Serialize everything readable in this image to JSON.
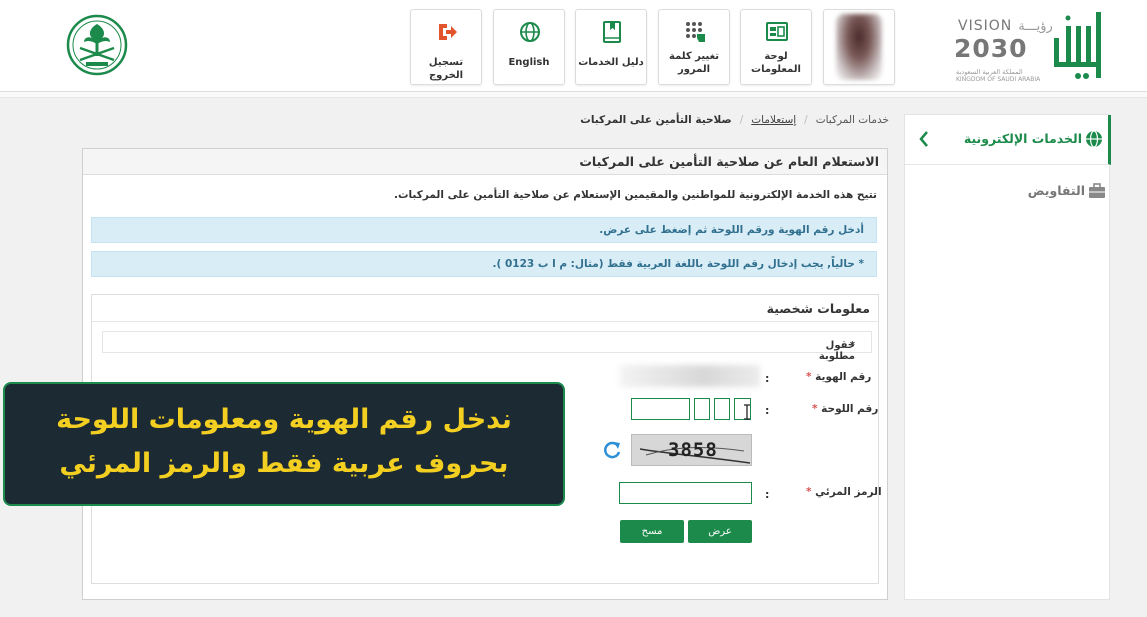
{
  "header": {
    "logo": {
      "vision_word": "VISION",
      "vision_arabic": "رؤيـــة",
      "year": "2030",
      "kingdom_ar": "المملكة العربية السعودية",
      "kingdom_en": "KINGDOM OF SAUDI ARABIA",
      "icon": "absher-logo"
    },
    "tiles": [
      {
        "label": "",
        "icon": "user-avatar"
      },
      {
        "label": "لوحة المعلومات",
        "icon": "dashboard-icon"
      },
      {
        "label": "تغيير كلمة المرور",
        "icon": "keypad-icon"
      },
      {
        "label": "دليل الخدمات",
        "icon": "book-icon"
      },
      {
        "label": "English",
        "icon": "globe-icon"
      },
      {
        "label": "تسجيل الخروج",
        "icon": "logout-icon"
      }
    ],
    "emblem": "saudi-emblem"
  },
  "sidebar": {
    "items": [
      {
        "label": "الخدمات الإلكترونية",
        "icon": "globe-icon",
        "active": true
      },
      {
        "label": "التفاويض",
        "icon": "briefcase-icon",
        "active": false
      }
    ]
  },
  "breadcrumb": {
    "items": [
      "خدمات المركبات",
      "إستعلامات",
      "صلاحية التأمين على المركبات"
    ]
  },
  "panel": {
    "title": "الاستعلام العام عن صلاحية التأمين على المركبات",
    "intro": "تتيح هذه الخدمة الإلكترونية للمواطنين والمقيمين الإستعلام عن صلاحية التأمين على المركبات.",
    "alert1": "أدخل رقم الهوية ورقم اللوحة ثم إضغط على عرض.",
    "alert2": "* حالياً, يجب إدخال رقم اللوحة باللغة العربية فقط (مثال: م ا ب 0123 )."
  },
  "form": {
    "section_title": "معلومات شخصية",
    "required_note": "حقول مطلوبة",
    "id_label": "رقم الهوية",
    "plate_label": "رقم اللوحة",
    "captcha_label": "الرمز المرئي",
    "captcha_text": "3858",
    "colon": ":",
    "star": "*",
    "submit_label": "عرض",
    "clear_label": "مسح"
  },
  "overlay": {
    "line1": "ندخل رقم الهوية ومعلومات اللوحة",
    "line2": "بحروف عربية فقط والرمز المرئي"
  },
  "colors": {
    "brand_green": "#1c8a4b",
    "caption_yellow": "#f3cf21",
    "alert_bg": "#d9edf7"
  }
}
